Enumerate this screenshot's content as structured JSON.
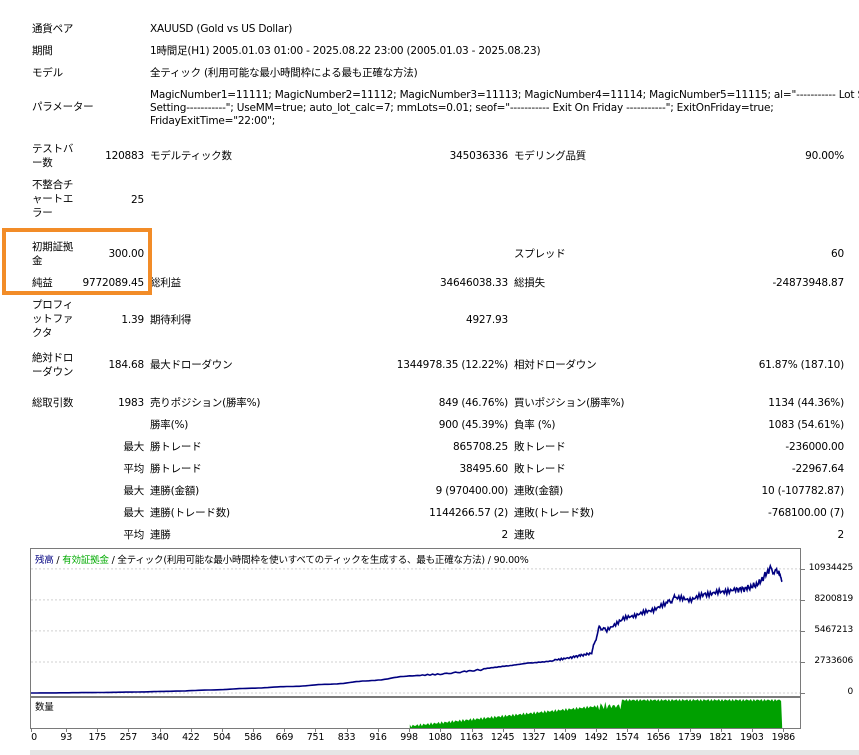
{
  "rows": {
    "symbol": {
      "label": "通貨ペア",
      "value": "XAUUSD (Gold vs US Dollar)"
    },
    "period": {
      "label": "期間",
      "value": "1時間足(H1) 2005.01.03 01:00 - 2025.08.22 23:00 (2005.01.03 - 2025.08.23)"
    },
    "model": {
      "label": "モデル",
      "value": "全ティック (利用可能な最小時間枠による最も正確な方法)"
    },
    "params": {
      "label": "パラメーター",
      "line1": "MagicNumber1=11111; MagicNumber2=11112; MagicNumber3=11113; MagicNumber4=11114; MagicNumber5=11115; al=\"----------- Lot Size",
      "line2": "Setting-----------\"; UseMM=true; auto_lot_calc=7; mmLots=0.01; seof=\"----------- Exit On Friday -----------\"; ExitOnFriday=true;",
      "line3": "FridayExitTime=\"22:00\";"
    }
  },
  "stats": {
    "bars": {
      "l1": "テストバ",
      "l2": "ー数",
      "value": "120883"
    },
    "ticks": {
      "label": "モデルティック数",
      "value": "345036336"
    },
    "quality": {
      "label": "モデリング品質",
      "value": "90.00%"
    },
    "mismatch": {
      "l1": "不整合チ",
      "l2": "ャートエ",
      "l3": "ラー",
      "value": "25"
    },
    "deposit": {
      "l1": "初期証拠",
      "l2": "金",
      "value": "300.00"
    },
    "spread": {
      "label": "スプレッド",
      "value": "60"
    },
    "net": {
      "label": "純益",
      "value": "9772089.45"
    },
    "gross_profit": {
      "label": "総利益",
      "value": "34646038.33"
    },
    "gross_loss": {
      "label": "総損失",
      "value": "-24873948.87"
    },
    "pf": {
      "l1": "プロフィ",
      "l2": "ットファ",
      "l3": "クタ",
      "value": "1.39"
    },
    "expected": {
      "label": "期待利得",
      "value": "4927.93"
    },
    "abs_dd": {
      "l1": "絶対ドロ",
      "l2": "ーダウン",
      "value": "184.68"
    },
    "max_dd": {
      "label": "最大ドローダウン",
      "value": "1344978.35 (12.22%)"
    },
    "rel_dd": {
      "label": "相対ドローダウン",
      "value": "61.87% (187.10)"
    },
    "total": {
      "label": "総取引数",
      "value": "1983"
    },
    "short": {
      "label": "売りポジション(勝率%)",
      "value": "849 (46.76%)"
    },
    "long": {
      "label": "買いポジション(勝率%)",
      "value": "1134 (44.36%)"
    },
    "winrate": {
      "label": "勝率(%)",
      "value": "900 (45.39%)"
    },
    "lossrate": {
      "label": "負率 (%)",
      "value": "1083 (54.61%)"
    },
    "max_label": "最大",
    "avg_label": "平均",
    "largest_win": {
      "label": "勝トレード",
      "value": "865708.25"
    },
    "largest_loss": {
      "label": "敗トレード",
      "value": "-236000.00"
    },
    "avg_win": {
      "label": "勝トレード",
      "value": "38495.60"
    },
    "avg_loss": {
      "label": "敗トレード",
      "value": "-22967.64"
    },
    "max_consec_win": {
      "label": "連勝(金額)",
      "value": "9 (970400.00)"
    },
    "max_consec_loss": {
      "label": "連敗(金額)",
      "value": "10 (-107782.87)"
    },
    "max_consec_profit": {
      "label": "連勝(トレード数)",
      "value": "1144266.57 (2)"
    },
    "max_consec_lossamt": {
      "label": "連敗(トレード数)",
      "value": "-768100.00 (7)"
    },
    "avg_consec_win": {
      "label": "連勝",
      "value": "2"
    },
    "avg_consec_loss": {
      "label": "連敗",
      "value": "2"
    }
  },
  "chart_legend": {
    "balance": "残高",
    "sep1": " / ",
    "equity": "有効証拠金",
    "sep2": " / ",
    "model": "全ティック(利用可能な最小時間枠を使いすべてのティックを生成する、最も正確な方法)",
    "quality": " / 90.00%"
  },
  "volume_label": "数量",
  "colors": {
    "balance": "#000080",
    "equity": "#00aa00",
    "volume": "#00a000",
    "highlight": "#f28c28"
  },
  "chart_data": {
    "type": "line",
    "title": "",
    "xlabel": "",
    "ylabel": "",
    "x_ticks": [
      "0",
      "93",
      "175",
      "257",
      "340",
      "422",
      "504",
      "586",
      "669",
      "751",
      "833",
      "916",
      "998",
      "1080",
      "1163",
      "1245",
      "1327",
      "1409",
      "1492",
      "1574",
      "1656",
      "1739",
      "1821",
      "1903",
      "1986"
    ],
    "y_ticks": [
      "10934425",
      "8200819",
      "5467213",
      "2733606",
      "0"
    ],
    "xlim": [
      0,
      2030
    ],
    "ylim": [
      0,
      11800000
    ],
    "series": [
      {
        "values_x": [
          0,
          100,
          200,
          300,
          400,
          500,
          600,
          700,
          800,
          900,
          1000,
          1080,
          1150,
          1200,
          1260,
          1320,
          1380,
          1420,
          1450,
          1480,
          1500,
          1520,
          1560,
          1600,
          1640,
          1680,
          1700,
          1740,
          1780,
          1820,
          1860,
          1890,
          1920,
          1950,
          1970,
          1983
        ],
        "values_y": [
          300,
          20000,
          50000,
          100000,
          180000,
          300000,
          450000,
          600000,
          800000,
          1100000,
          1500000,
          1650000,
          1900000,
          2100000,
          2350000,
          2700000,
          2900000,
          3100000,
          3300000,
          3500000,
          5800000,
          5500000,
          6500000,
          6900000,
          7300000,
          7900000,
          8400000,
          8200000,
          8700000,
          8900000,
          9100000,
          9200000,
          9600000,
          10900000,
          10600000,
          9800000
        ]
      }
    ]
  }
}
